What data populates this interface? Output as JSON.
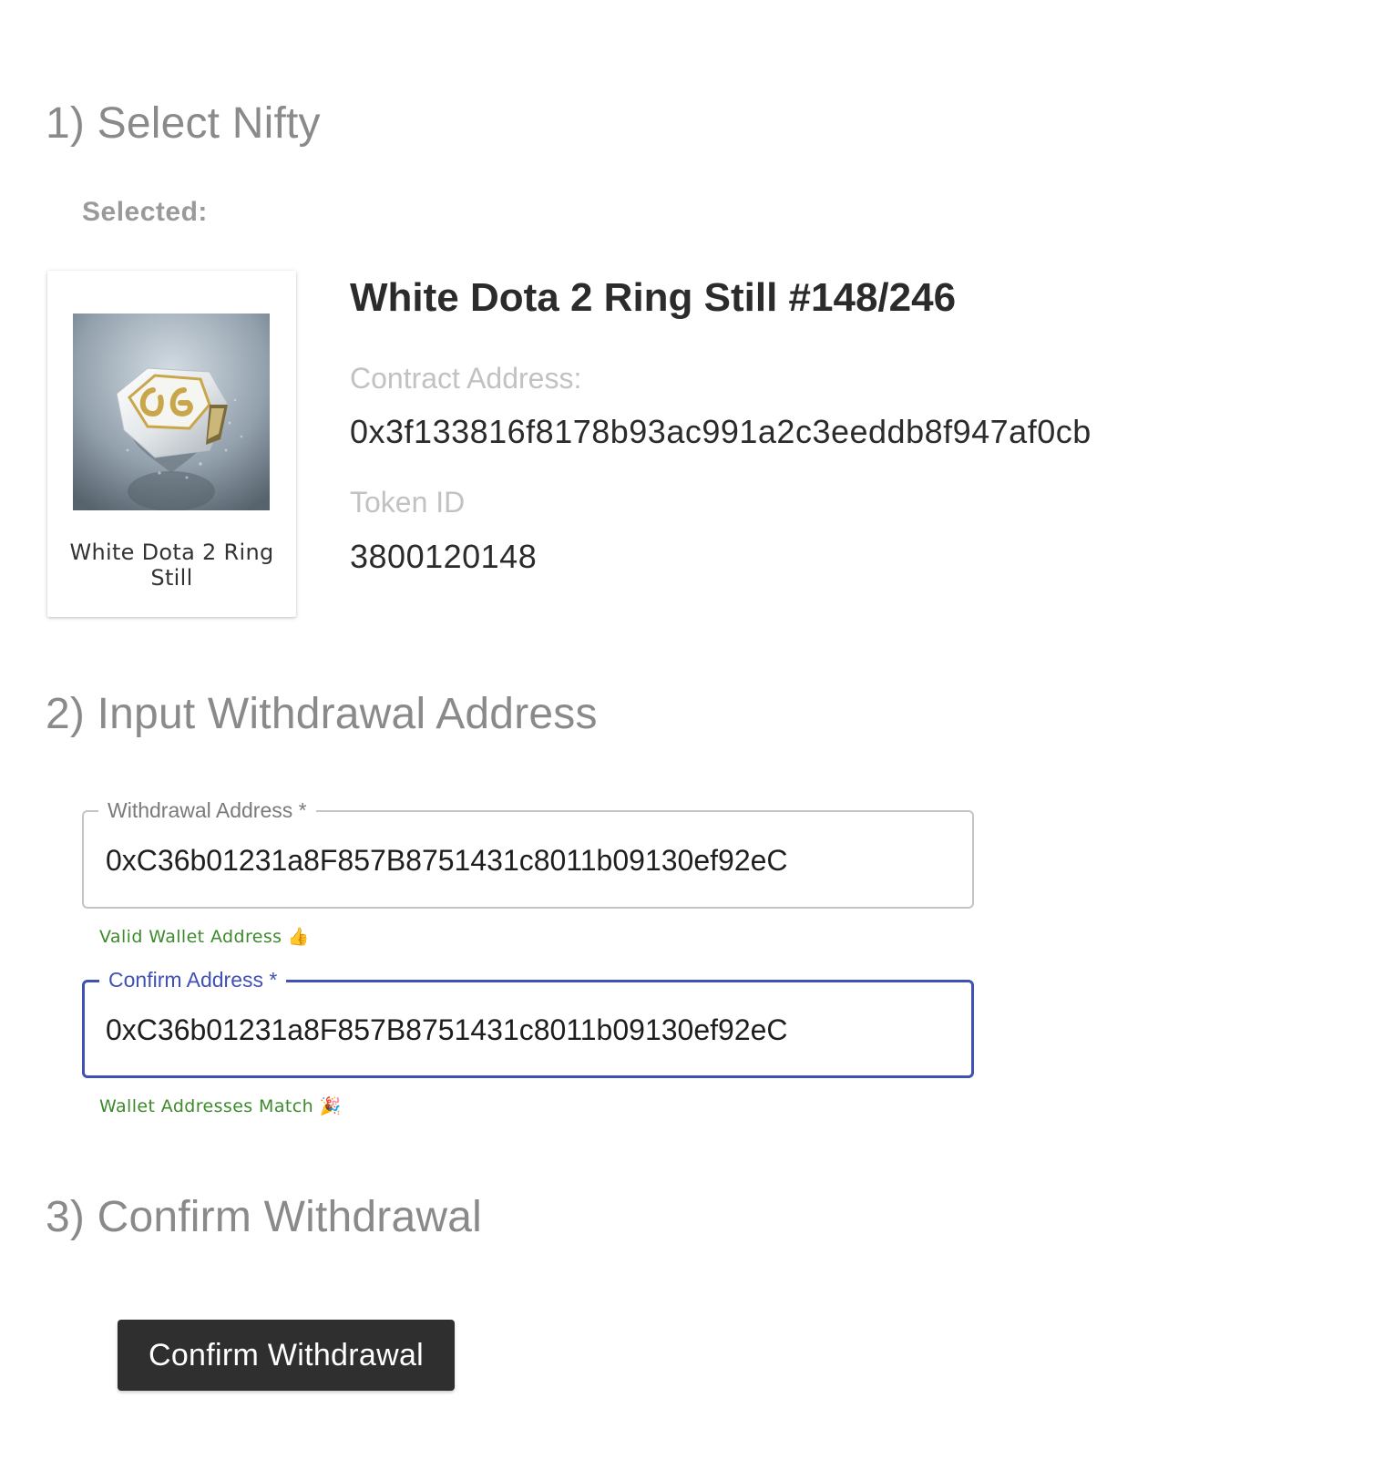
{
  "steps": {
    "select_heading": "1) Select Nifty",
    "input_heading": "2) Input Withdrawal Address",
    "confirm_heading": "3) Confirm Withdrawal"
  },
  "selection": {
    "label": "Selected:",
    "card_caption": "White Dota 2 Ring Still",
    "image_icon": "ring-image",
    "title": "White Dota 2 Ring Still #148/246",
    "contract_label": "Contract Address:",
    "contract_address": "0x3f133816f8178b93ac991a2c3eeddb8f947af0cb",
    "token_label": "Token ID",
    "token_id": "3800120148"
  },
  "form": {
    "withdrawal": {
      "label": "Withdrawal Address *",
      "value": "0xC36b01231a8F857B8751431c8011b09130ef92eC",
      "helper": "Valid Wallet Address 👍"
    },
    "confirm": {
      "label": "Confirm Address *",
      "value": "0xC36b01231a8F857B8751431c8011b09130ef92eC",
      "helper": "Wallet Addresses Match 🎉"
    }
  },
  "actions": {
    "confirm_button": "Confirm Withdrawal"
  },
  "colors": {
    "heading": "#8a8a8a",
    "focus": "#3f51b5",
    "success": "#3d8a2c",
    "button": "#2f2f2f"
  }
}
